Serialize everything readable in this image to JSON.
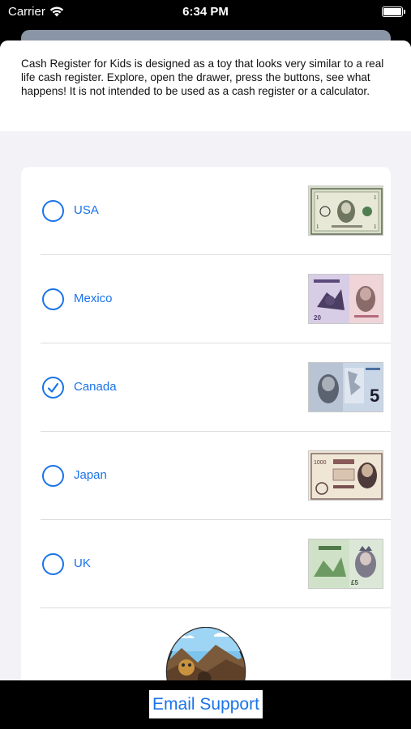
{
  "status_bar": {
    "carrier": "Carrier",
    "time": "6:34 PM"
  },
  "description": "Cash Register for Kids is designed as a toy that looks very similar to a real life cash register. Explore, open the drawer, press the buttons, see what happens! It is not intended to be used as a cash register or a calculator.",
  "currencies": [
    {
      "label": "USA",
      "selected": false
    },
    {
      "label": "Mexico",
      "selected": false
    },
    {
      "label": "Canada",
      "selected": true
    },
    {
      "label": "Japan",
      "selected": false
    },
    {
      "label": "UK",
      "selected": false
    }
  ],
  "footer": {
    "email_button": "Email Support"
  },
  "colors": {
    "accent": "#1a73e8",
    "background": "#f2f2f7",
    "bar": "#000000"
  }
}
